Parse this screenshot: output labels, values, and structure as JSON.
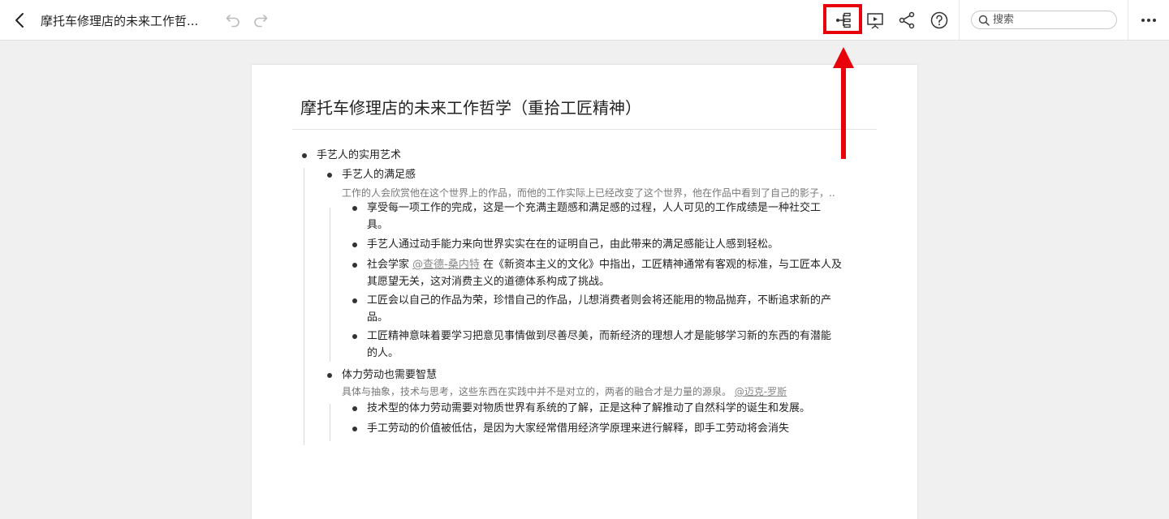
{
  "topbar": {
    "doc_title": "摩托车修理店的未来工作哲...",
    "search_placeholder": "搜索"
  },
  "icons": {
    "back": "chevron-left-icon",
    "undo": "undo-icon",
    "redo": "redo-icon",
    "outline": "outline-tree-icon",
    "present": "presentation-icon",
    "share": "share-icon",
    "help": "help-circle-icon",
    "search": "search-icon",
    "more": "more-horizontal-icon"
  },
  "colors": {
    "highlight": "#e8000b",
    "page_bg": "#f0f0f0",
    "note_text": "#777777",
    "mention_text": "#888888"
  },
  "document": {
    "title": "摩托车修理店的未来工作哲学（重拾工匠精神）",
    "root": {
      "text": "手艺人的实用艺术",
      "children": [
        {
          "text": "手艺人的满足感",
          "note": "工作的人会欣赏他在这个世界上的作品，而他的工作实际上已经改变了这个世界，他在作品中看到了自己的影子，..",
          "items": [
            {
              "line1": "享受每一项工作的完成，这是一个充满主题感和满足感的过程，人人可见的工作成绩是一种社交工",
              "line2": "具。"
            },
            {
              "line1": "手艺人通过动手能力来向世界实实在在的证明自己，由此带来的满足感能让人感到轻松。",
              "line2": ""
            },
            {
              "line1_pre": "社会学家 ",
              "line1_mention": "@查德-桑内特",
              "line1_post": " 在《新资本主义的文化》中指出，工匠精神通常有客观的标准，与工匠本人及",
              "line2": "其愿望无关，这对消费主义的道德体系构成了挑战。"
            },
            {
              "line1": "工匠会以自己的作品为荣，珍惜自己的作品，儿想消费者则会将还能用的物品抛弃，不断追求新的产",
              "line2": "品。"
            },
            {
              "line1": "工匠精神意味着要学习把意见事情做到尽善尽美，而新经济的理想人才是能够学习新的东西的有潜能",
              "line2": "的人。"
            }
          ]
        },
        {
          "text": "体力劳动也需要智慧",
          "note_pre": "具体与抽象，技术与思考，这些东西在实践中并不是对立的，两者的融合才是力量的源泉。 ",
          "note_mention": "@迈克-罗斯",
          "items": [
            {
              "line1": "技术型的体力劳动需要对物质世界有系统的了解，正是这种了解推动了自然科学的诞生和发展。",
              "line2": ""
            },
            {
              "line1": "手工劳动的价值被低估，是因为大家经常借用经济学原理来进行解释，即手工劳动将会消失",
              "line2": ""
            }
          ]
        }
      ]
    }
  }
}
